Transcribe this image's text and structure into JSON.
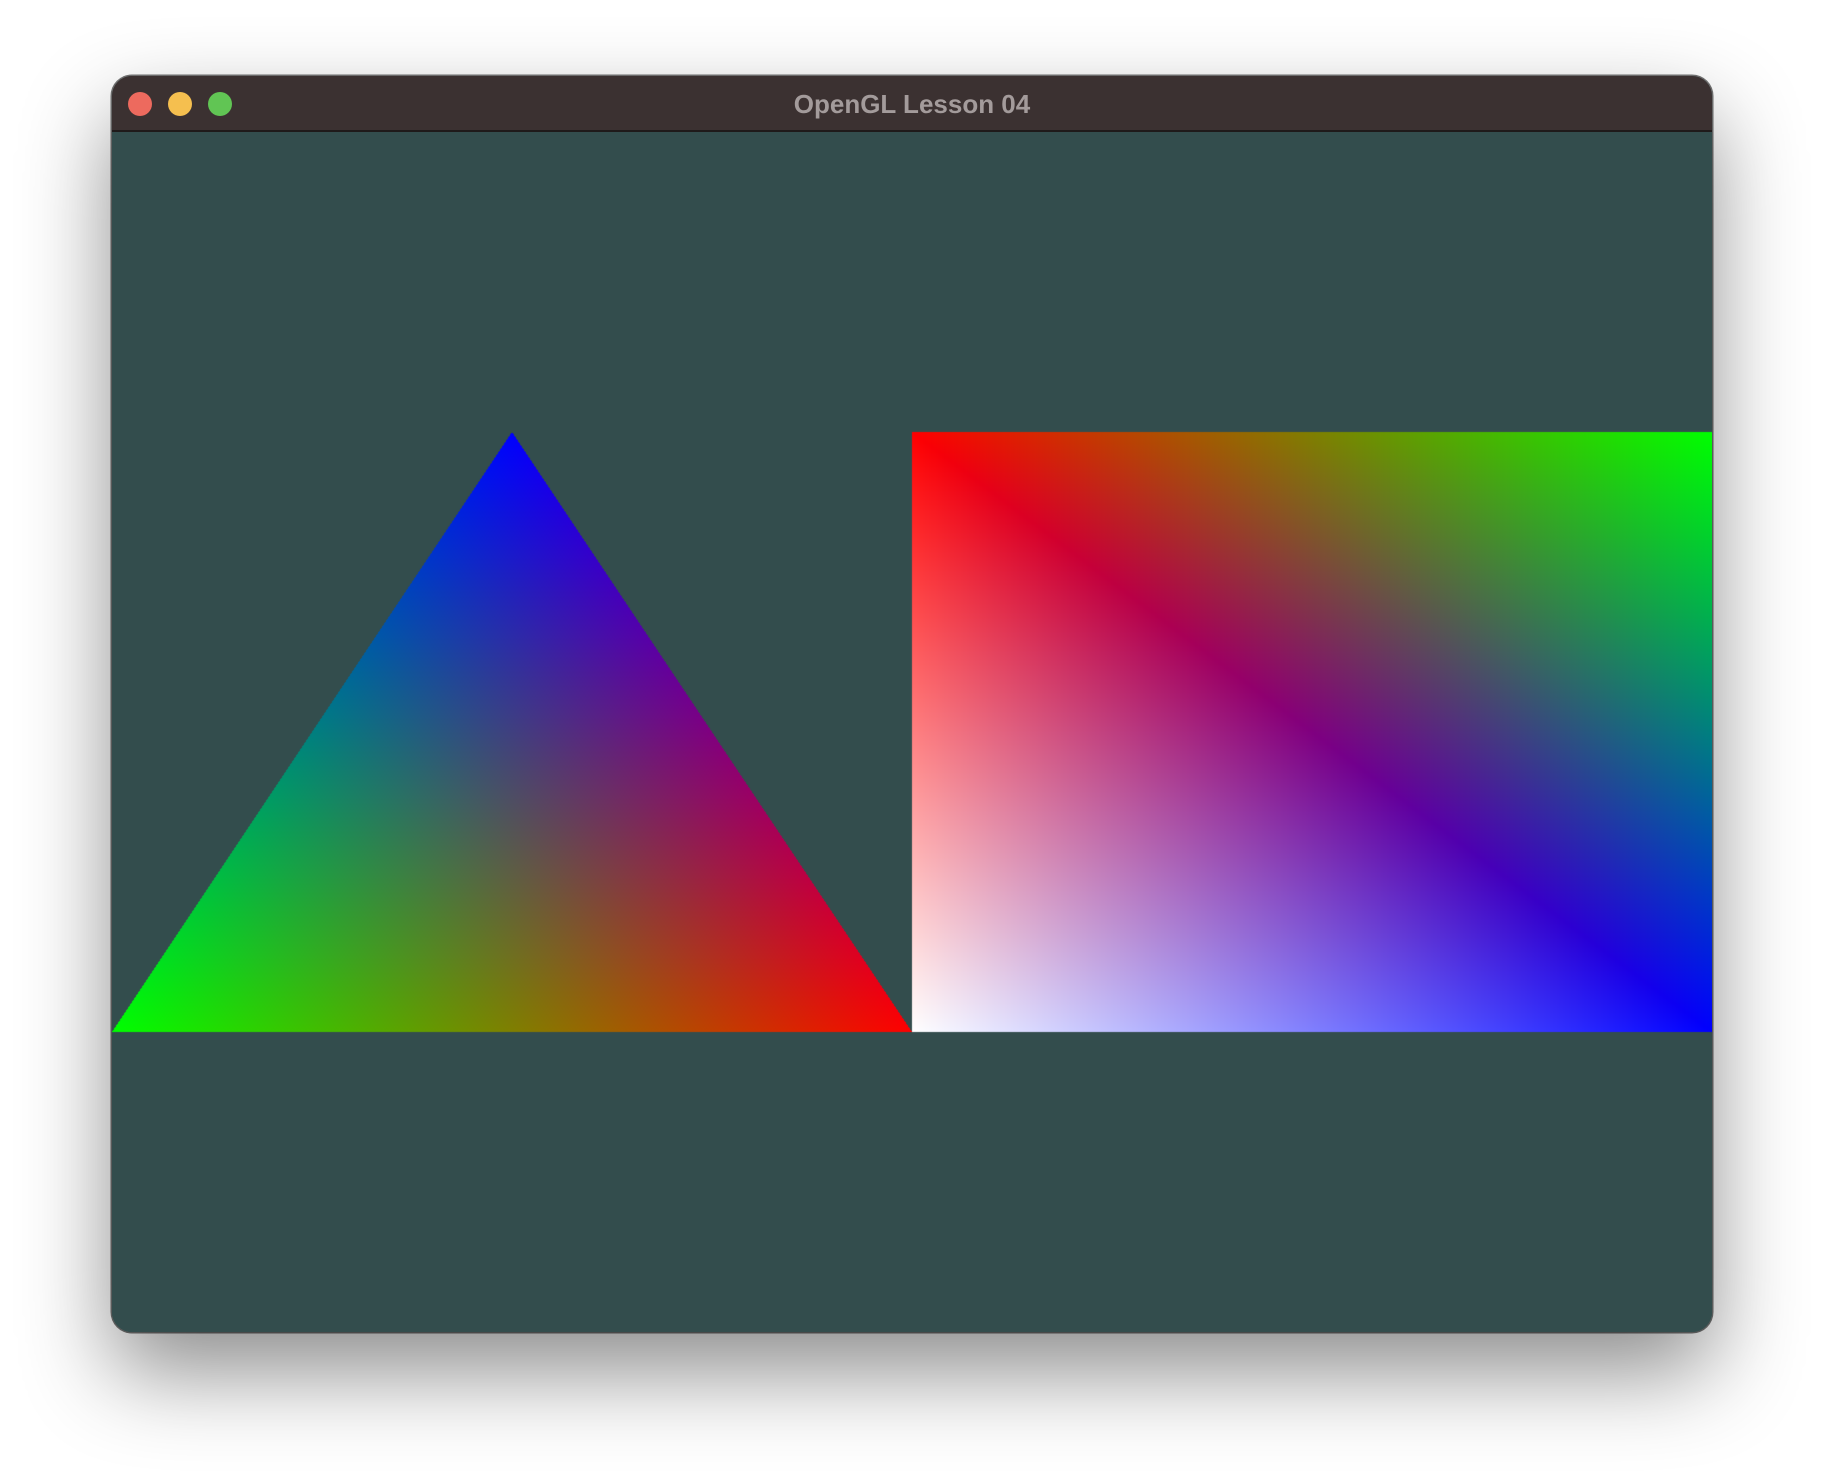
{
  "window": {
    "title": "OpenGL Lesson 04",
    "controls": [
      "close-icon",
      "minimize-icon",
      "maximize-icon"
    ],
    "control_colors": {
      "close": "#ed6a5e",
      "minimize": "#f5bf4f",
      "maximize": "#61c554"
    }
  },
  "scene": {
    "clear_color": "#334d4d",
    "triangle": {
      "vertex_colors": {
        "top": "#0000ff",
        "bottom_left": "#00ff00",
        "bottom_right": "#ff0000"
      }
    },
    "rectangle": {
      "corner_colors": {
        "top_left": "#ff0000",
        "top_right": "#00ff00",
        "bottom_right": "#0000ff",
        "bottom_left": "#ffffff"
      }
    }
  }
}
